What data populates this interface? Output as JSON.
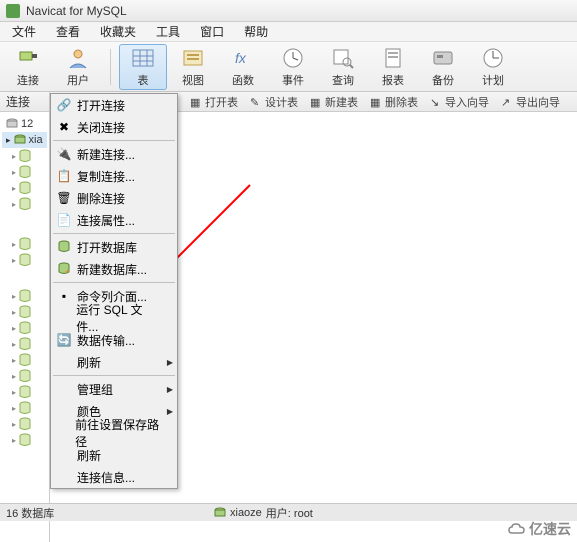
{
  "title": "Navicat for MySQL",
  "menus": [
    "文件",
    "查看",
    "收藏夹",
    "工具",
    "窗口",
    "帮助"
  ],
  "toolbar": [
    {
      "label": "连接",
      "icon": "plug"
    },
    {
      "label": "用户",
      "icon": "user"
    },
    {
      "label": "表",
      "icon": "table",
      "selected": true
    },
    {
      "label": "视图",
      "icon": "view"
    },
    {
      "label": "函数",
      "icon": "fx"
    },
    {
      "label": "事件",
      "icon": "event"
    },
    {
      "label": "查询",
      "icon": "query"
    },
    {
      "label": "报表",
      "icon": "report"
    },
    {
      "label": "备份",
      "icon": "backup"
    },
    {
      "label": "计划",
      "icon": "plan"
    }
  ],
  "subbar_left": "连接",
  "subbar": [
    "打开表",
    "设计表",
    "新建表",
    "删除表",
    "导入向导",
    "导出向导"
  ],
  "tree": {
    "items": [
      {
        "label": "12"
      },
      {
        "label": "xia",
        "selected": true
      }
    ]
  },
  "context_menu": [
    {
      "label": "打开连接",
      "icon": "link"
    },
    {
      "label": "关闭连接",
      "icon": "close"
    },
    {
      "divider": true
    },
    {
      "label": "新建连接...",
      "icon": "newlink"
    },
    {
      "label": "复制连接...",
      "icon": "copy"
    },
    {
      "label": "删除连接",
      "icon": "delete"
    },
    {
      "label": "连接属性...",
      "icon": "props"
    },
    {
      "divider": true
    },
    {
      "label": "打开数据库",
      "icon": "opendb"
    },
    {
      "label": "新建数据库...",
      "icon": "newdb",
      "highlight": true
    },
    {
      "divider": true
    },
    {
      "label": "命令列介面...",
      "icon": "cmd"
    },
    {
      "label": "运行 SQL 文件...",
      "icon": ""
    },
    {
      "label": "数据传输...",
      "icon": "transfer"
    },
    {
      "label": "刷新",
      "submenu": true
    },
    {
      "divider": true
    },
    {
      "label": "管理组",
      "submenu": true
    },
    {
      "label": "颜色",
      "submenu": true
    },
    {
      "label": "前往设置保存路径"
    },
    {
      "label": "刷新"
    },
    {
      "label": "连接信息..."
    }
  ],
  "status": {
    "left": "16 数据库",
    "right_conn": "xiaoze",
    "right_user": "用户: root"
  },
  "watermark": "亿速云"
}
